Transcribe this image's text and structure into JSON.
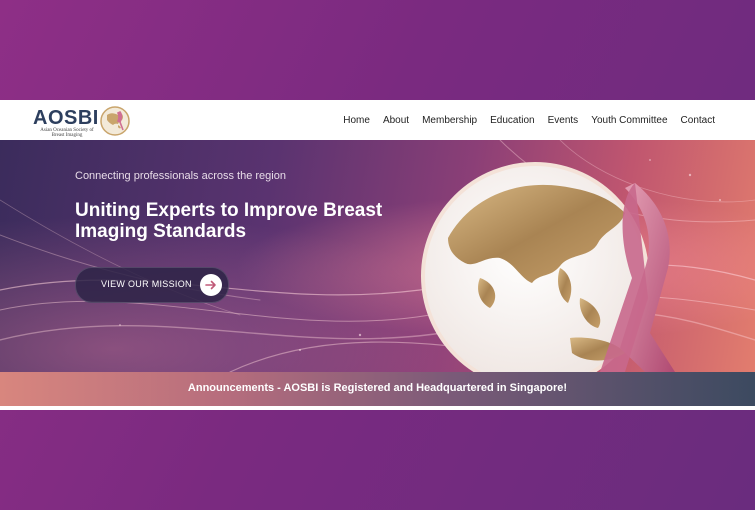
{
  "logo": {
    "text": "AOSBI",
    "subtitle": "Asian Oceanian Society of Breast Imaging"
  },
  "nav": {
    "items": [
      "Home",
      "About",
      "Membership",
      "Education",
      "Events",
      "Youth Committee",
      "Contact"
    ]
  },
  "hero": {
    "tagline": "Connecting professionals across the region",
    "headline": "Uniting Experts to Improve Breast Imaging Standards",
    "cta_label": "VIEW OUR MISSION"
  },
  "announcement": {
    "text": "Announcements - AOSBI is Registered and Headquartered in Singapore!"
  },
  "icons": [
    "globe-icon",
    "pink-ribbon-icon",
    "arrow-right-icon"
  ],
  "colors": {
    "outer_background": "#7a2a80",
    "logo_text": "#2d3f5e",
    "ribbon": "#c0577a",
    "globe_gold": "#b89058"
  }
}
